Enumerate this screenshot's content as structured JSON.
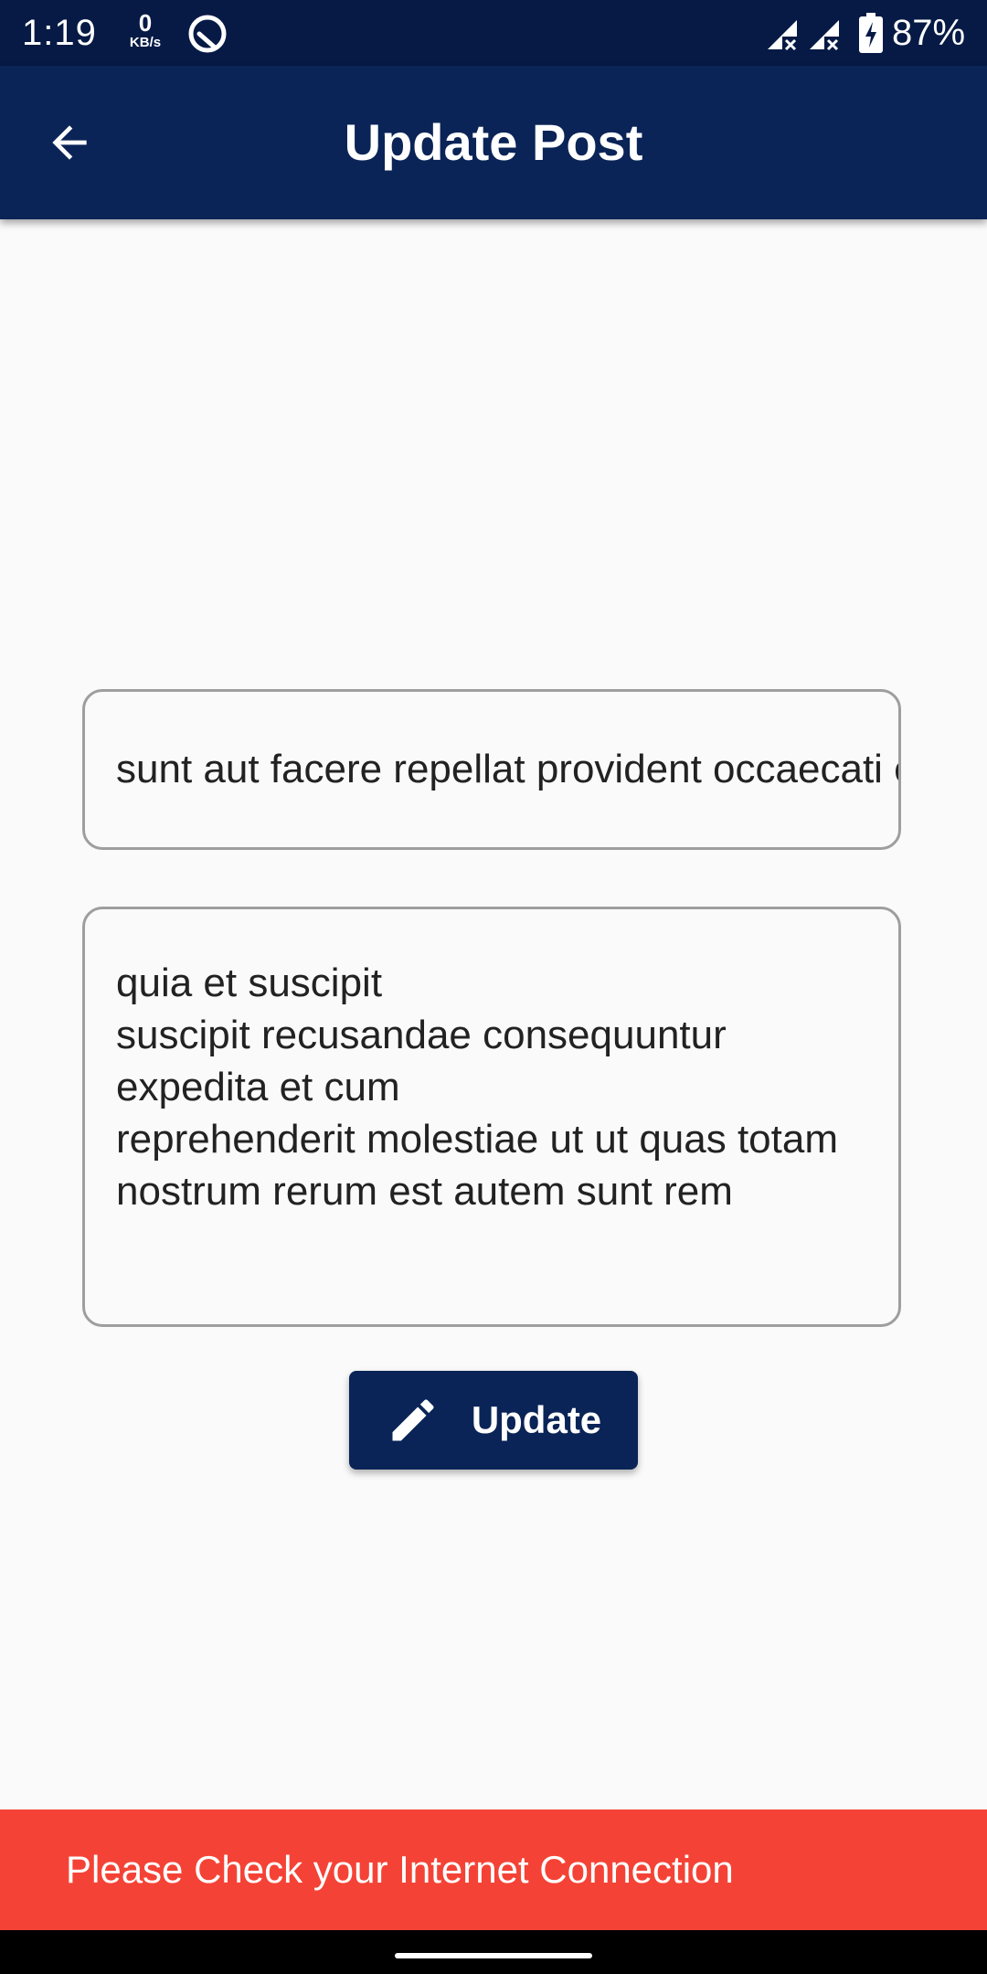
{
  "status_bar": {
    "time": "1:19",
    "speed_value": "0",
    "speed_unit": "KB/s",
    "battery": "87%",
    "icons": [
      "q-app-icon",
      "signal-x-icon",
      "signal-x-icon",
      "battery-charging-icon"
    ]
  },
  "app_bar": {
    "title": "Update Post",
    "back_icon": "arrow-back-icon"
  },
  "form": {
    "title_value": "sunt aut facere repellat provident occaecati excepturi optio reprehenderit",
    "body_value": "quia et suscipit\nsuscipit recusandae consequuntur expedita et cum\nreprehenderit molestiae ut ut quas totam\nnostrum rerum est autem sunt rem",
    "update_label": "Update",
    "update_icon": "pencil-icon"
  },
  "snackbar": {
    "message": "Please Check your Internet Connection"
  },
  "colors": {
    "status_bar": "#061a45",
    "app_bar": "#0a2457",
    "background": "#fafafa",
    "snackbar": "#f44336",
    "field_border": "#9e9e9e"
  }
}
